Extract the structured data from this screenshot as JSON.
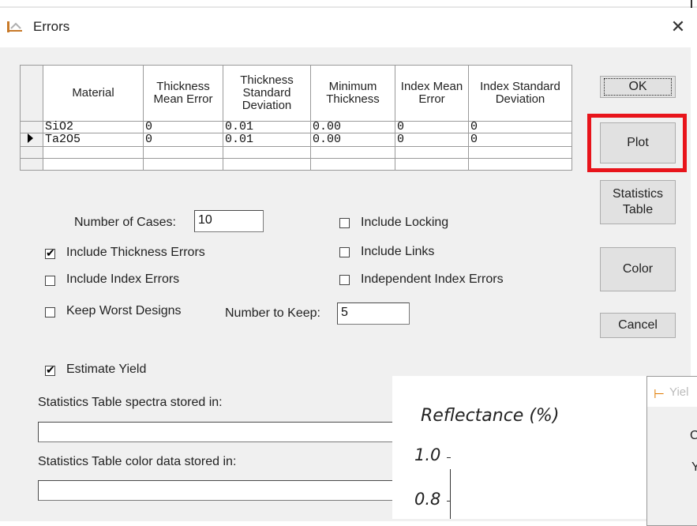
{
  "window": {
    "title": "Errors",
    "close_glyph": "✕"
  },
  "table": {
    "headers": [
      "Material",
      "Thickness Mean Error",
      "Thickness Standard Deviation",
      "Minimum Thickness",
      "Index Mean Error",
      "Index Standard Deviation"
    ],
    "rows": [
      [
        "SiO2",
        "0",
        "0.01",
        "0.00",
        "0",
        "0"
      ],
      [
        "Ta2O5",
        "0",
        "0.01",
        "0.00",
        "0",
        "0"
      ]
    ]
  },
  "buttons": {
    "ok": "OK",
    "plot": "Plot",
    "stats_1": "Statistics",
    "stats_2": "Table",
    "color": "Color",
    "cancel": "Cancel"
  },
  "options": {
    "num_cases_label": "Number of Cases:",
    "num_cases_value": "10",
    "include_thickness": "Include Thickness Errors",
    "include_thickness_checked": true,
    "include_index": "Include Index Errors",
    "include_index_checked": false,
    "keep_worst": "Keep Worst Designs",
    "keep_worst_checked": false,
    "number_to_keep_label": "Number to Keep:",
    "number_to_keep_value": "5",
    "include_locking": "Include Locking",
    "include_links": "Include Links",
    "independent_index": "Independent Index Errors",
    "estimate_yield": "Estimate Yield",
    "estimate_yield_checked": true,
    "spectra_label": "Statistics Table spectra stored in:",
    "color_data_label": "Statistics Table color data stored in:"
  },
  "overlay": {
    "ylabel": "Reflectance (%)",
    "tick_1": "1.0",
    "tick_2": "0.8"
  },
  "yield_window": {
    "title": "Yiel",
    "letter_c": "C",
    "letter_y": "Y"
  },
  "colors": {
    "highlight": "#e8141b",
    "dialog_bg": "#f0f0f0"
  }
}
